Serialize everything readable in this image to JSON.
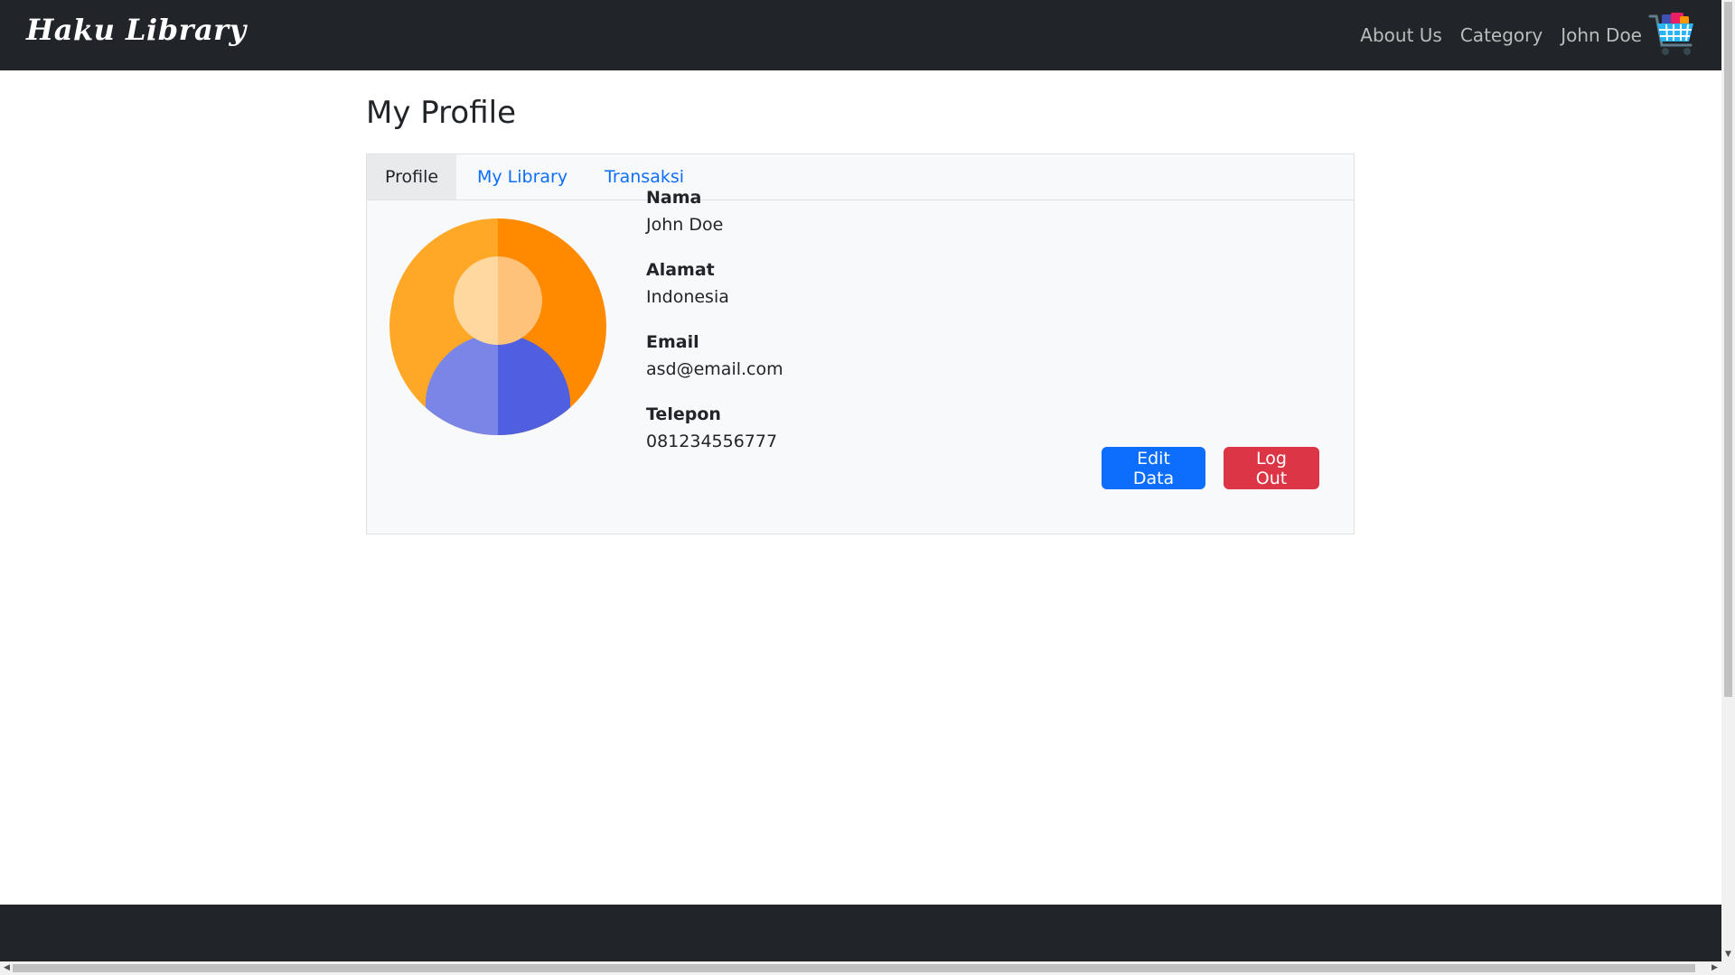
{
  "navbar": {
    "brand": "Haku Library",
    "links": [
      "About Us",
      "Category",
      "John Doe"
    ]
  },
  "profile": {
    "title": "My Profile",
    "tabs": [
      {
        "label": "Profile",
        "active": true
      },
      {
        "label": "My Library",
        "active": false
      },
      {
        "label": "Transaksi",
        "active": false
      }
    ],
    "fields": [
      {
        "label": "Nama",
        "value": "John Doe"
      },
      {
        "label": "Alamat",
        "value": "Indonesia"
      },
      {
        "label": "Email",
        "value": "asd@email.com"
      },
      {
        "label": "Telepon",
        "value": "081234556777"
      }
    ],
    "buttons": {
      "edit": "Edit Data",
      "logout": "Log Out"
    }
  },
  "colors": {
    "navbar": "#212529",
    "primary": "#0d6efd",
    "danger": "#dc3545",
    "link": "#0d6efd"
  },
  "icons": {
    "cart": "shopping-cart-icon",
    "avatar": "user-avatar-icon"
  }
}
